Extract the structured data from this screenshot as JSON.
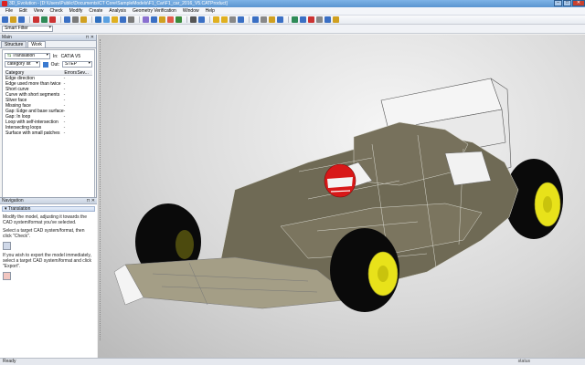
{
  "window": {
    "title": "3D_Evolution - [D:\\Users\\Public\\Documents\\CT Core\\SampleModels\\F1_Car\\F1_car_2016_V5.CATProduct]",
    "minimize": "–",
    "maximize": "□",
    "close": "✕"
  },
  "menu": [
    "File",
    "Edit",
    "View",
    "Check",
    "Modify",
    "Create",
    "Analysis",
    "Geometry Verification",
    "Window",
    "Help"
  ],
  "filter": {
    "value": "Smart Filter"
  },
  "main_panel": {
    "title": "Main",
    "tabs": [
      "Structure",
      "Work"
    ],
    "active_tab": "Work",
    "mode": "Translation",
    "in_label": "In:",
    "in_value": "CATIA V5",
    "category_filter": "category lst",
    "out_label": "Out:",
    "out_value": "STEP",
    "columns": [
      "Category",
      "Errors",
      "Sev..."
    ],
    "categories": [
      {
        "name": "Edge direction",
        "errors": "-"
      },
      {
        "name": "Edge used more than twice",
        "errors": "-"
      },
      {
        "name": "Short curve",
        "errors": "-"
      },
      {
        "name": "Curve with short segments",
        "errors": "-"
      },
      {
        "name": "Sliver face",
        "errors": "-"
      },
      {
        "name": "Missing face",
        "errors": "-"
      },
      {
        "name": "Gap: Edge and base surface",
        "errors": "-"
      },
      {
        "name": "Gap: In loop",
        "errors": "-"
      },
      {
        "name": "Loop with self-intersection",
        "errors": "-"
      },
      {
        "name": "Intersecting loops",
        "errors": "-"
      },
      {
        "name": "Surface with small patches",
        "errors": "-"
      }
    ]
  },
  "navigation": {
    "title": "Navigation",
    "section": "Translation",
    "p1": "Modify the model, adjusting it towards the CAD system/format you've selected.",
    "p2": "Select a target CAD system/format, then click \"Check\".",
    "p3": "If you wish to export the model immediately, select a target CAD system/format and click \"Export\"."
  },
  "status": {
    "left": "Ready",
    "right": "status"
  },
  "colors": {
    "body": "#6f6a55",
    "tire": "#0a0a0a",
    "rim": "#e8e21a",
    "helmet": "#d81818",
    "wing": "#ffffff"
  }
}
